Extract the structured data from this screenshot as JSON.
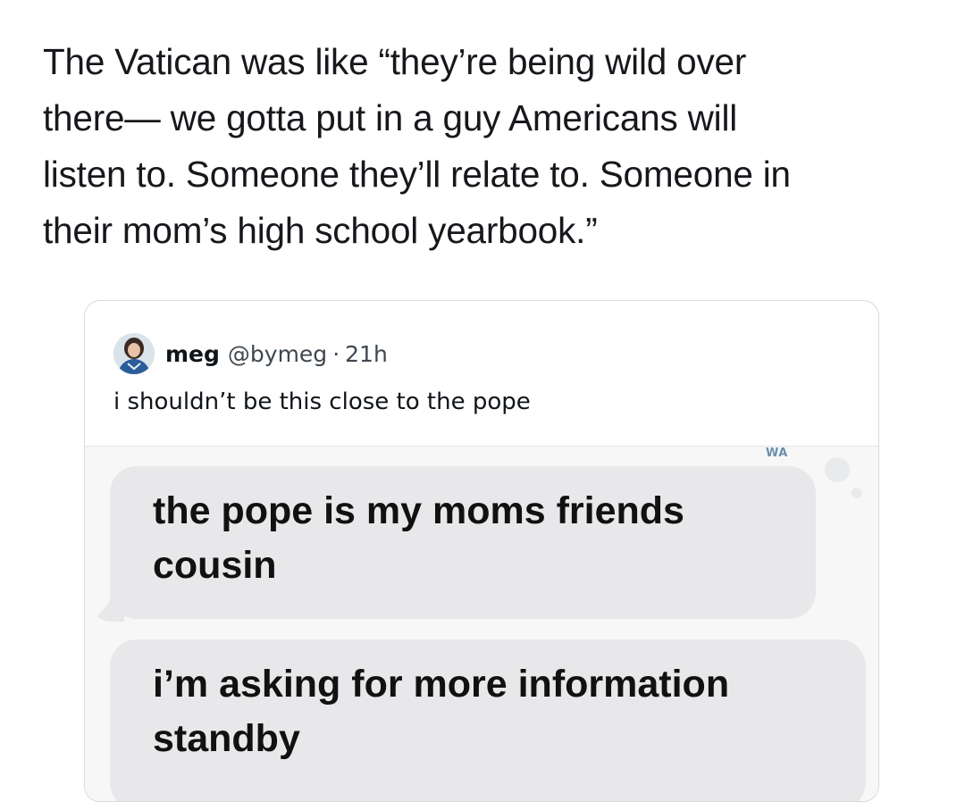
{
  "post": {
    "text": "The Vatican was like “they’re being wild over\nthere— we gotta put in a guy Americans will\nlisten to. Someone they’ll relate to. Someone in\ntheir mom’s high school yearbook.”"
  },
  "quoted_tweet": {
    "author_name": "meg",
    "author_handle": "@bymeg",
    "separator": "·",
    "time": "21h",
    "text": "i shouldn’t be this close to the pope",
    "media": {
      "watermark": "WA",
      "messages": [
        {
          "text": "the pope is my moms friends\ncousin"
        },
        {
          "text": "i’m asking for more information\nstandby"
        }
      ]
    }
  },
  "colors": {
    "bubble": "#e8e8ea",
    "card_border": "#d6dadf",
    "handle_gray": "#3f474f"
  }
}
